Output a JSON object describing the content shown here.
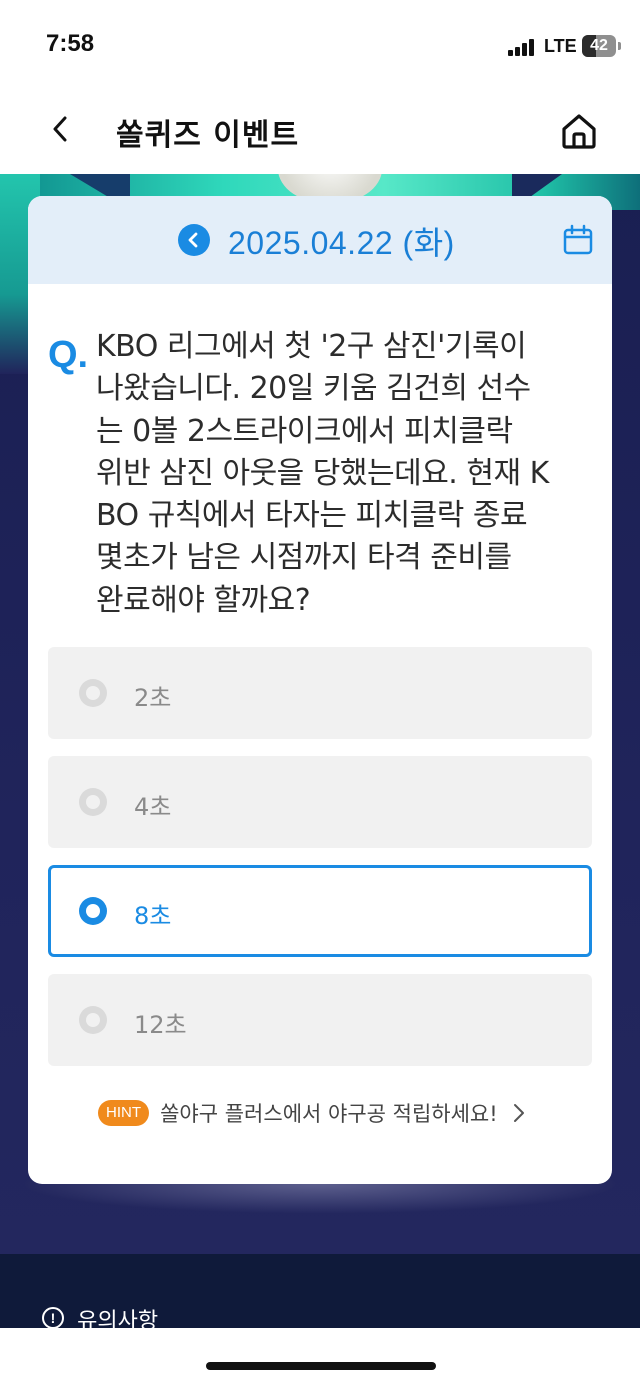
{
  "status_bar": {
    "time": "7:58",
    "network": "LTE",
    "battery": "42",
    "battery_level_percent": 42
  },
  "header": {
    "title": "쏠퀴즈 이벤트",
    "back_icon": "chevron-left-icon",
    "home_icon": "home-icon"
  },
  "quiz": {
    "date": "2025.04.22 (화)",
    "prev_icon": "chevron-left-circle-icon",
    "calendar_icon": "calendar-icon",
    "question_mark": "Q.",
    "question_lines": [
      "KBO 리그에서 첫 '2구 삼진'기록이",
      "나왔습니다. 20일 키움 김건희 선수",
      "는 0볼 2스트라이크에서 피치클락",
      "위반 삼진 아웃을 당했는데요. 현재 K",
      "BO 규칙에서 타자는 피치클락 종료",
      "몇초가 남은 시점까지 타격 준비를",
      "완료해야 할까요?"
    ],
    "options": [
      {
        "label": "2초",
        "selected": false
      },
      {
        "label": "4초",
        "selected": false
      },
      {
        "label": "8초",
        "selected": true
      },
      {
        "label": "12초",
        "selected": false
      }
    ],
    "hint": {
      "badge": "HINT",
      "text": "쏠야구 플러스에서 야구공 적립하세요!",
      "chevron_icon": "chevron-right-icon"
    }
  },
  "footer": {
    "notice_icon": "info-circle-icon",
    "notice_label": "유의사항"
  },
  "colors": {
    "accent": "#1a8be3",
    "hint_badge": "#f08a1c",
    "date_bar": "#e3eef9",
    "backdrop": "#20245b",
    "option_bg": "#f1f1f1"
  }
}
